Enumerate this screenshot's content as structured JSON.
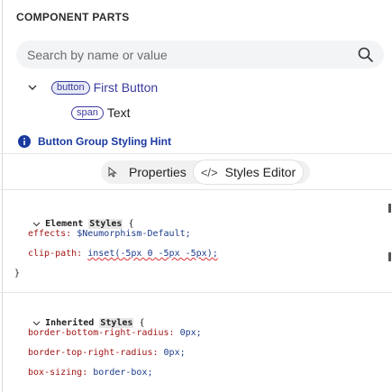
{
  "panel": {
    "title": "COMPONENT PARTS",
    "search_placeholder": "Search by name or value"
  },
  "tree": [
    {
      "tag": "button",
      "label": "First Button"
    },
    {
      "tag": "span",
      "label": "Text"
    }
  ],
  "hint": {
    "text": "Button Group Styling Hint"
  },
  "tabs": [
    {
      "label": "Properties",
      "icon": "pointer-icon"
    },
    {
      "label": "Styles Editor",
      "icon": "code-icon",
      "icon_text": "</>"
    }
  ],
  "styles": {
    "element": {
      "keyword": "Element",
      "highlight": "Styles",
      "open_brace": "{",
      "props": [
        {
          "name": "effects:",
          "value": "$Neumorphism-Default;"
        },
        {
          "name": "clip-path:",
          "value": "inset(-5px 0 -5px -5px);"
        }
      ],
      "close_brace": "}"
    },
    "inherited": {
      "keyword": "Inherited",
      "highlight": "Styles",
      "open_brace": "{",
      "props": [
        {
          "name": "border-bottom-right-radius:",
          "value": "0px;"
        },
        {
          "name": "border-top-right-radius:",
          "value": "0px;"
        },
        {
          "name": "box-sizing:",
          "value": "border-box;"
        }
      ]
    }
  },
  "colors": {
    "accent": "#3a3aa0",
    "hint": "#1a3aa0",
    "error_underline": "#dd3333"
  }
}
